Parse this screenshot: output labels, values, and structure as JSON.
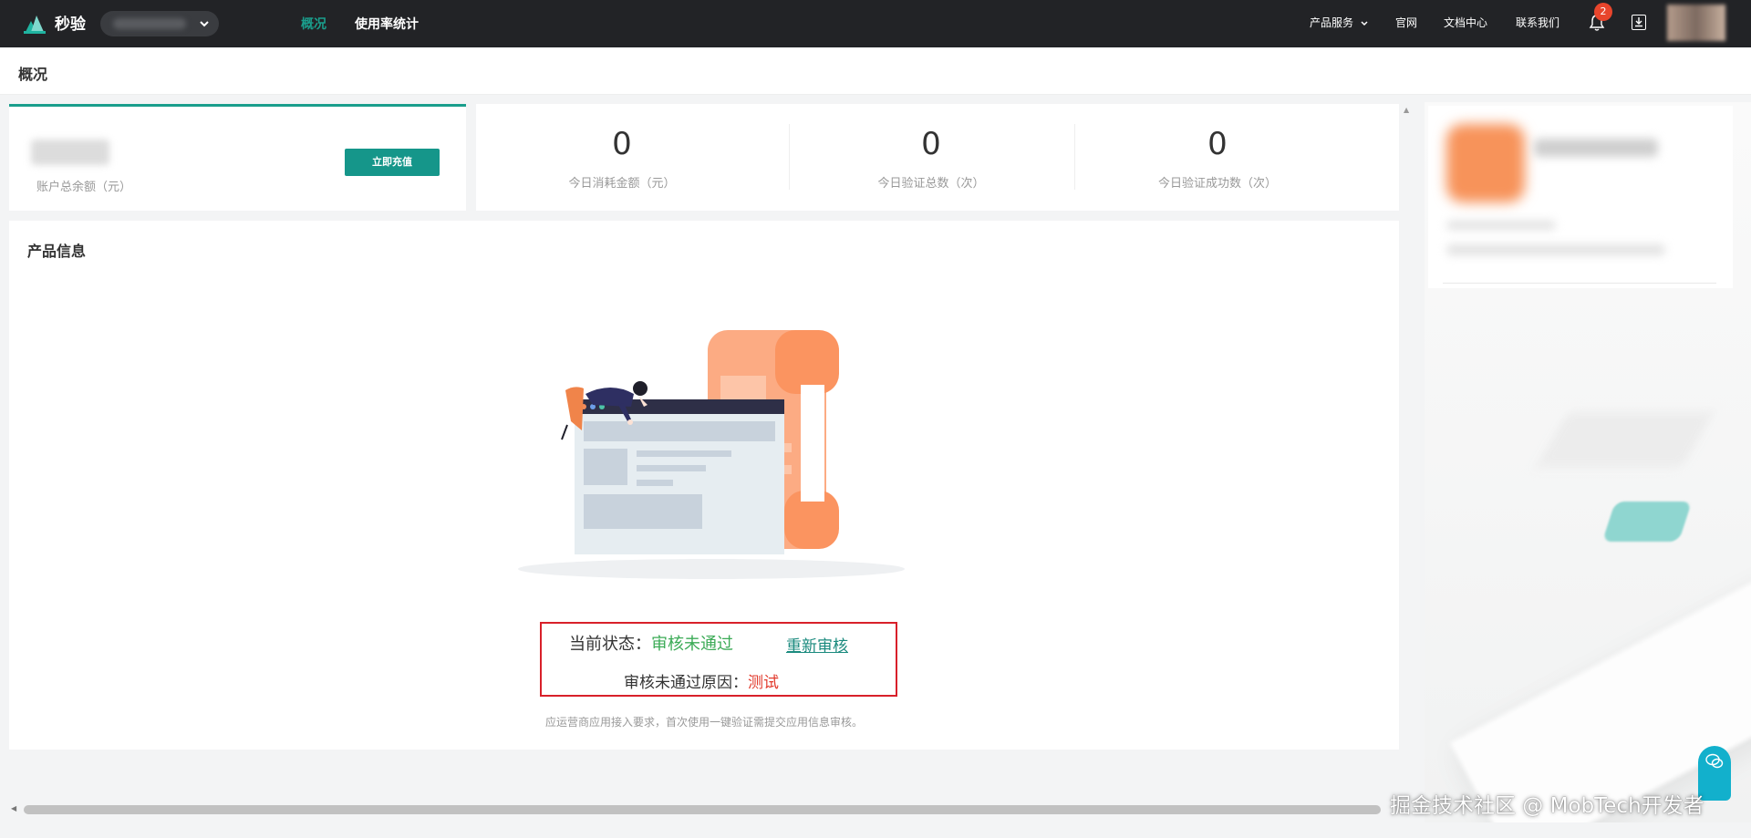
{
  "app": {
    "name": "秒验",
    "accent_color": "#1a9e8c"
  },
  "nav": {
    "tabs": [
      {
        "label": "概况",
        "active": true
      },
      {
        "label": "使用率统计",
        "active": false
      }
    ],
    "right": {
      "product_service": "产品服务",
      "official_site": "官网",
      "docs": "文档中心",
      "contact": "联系我们",
      "notification_count": "2"
    }
  },
  "page": {
    "title": "概况"
  },
  "balance": {
    "label": "账户总余额（元）",
    "recharge_button": "立即充值"
  },
  "stats": [
    {
      "value": "0",
      "label": "今日消耗金额（元）"
    },
    {
      "value": "0",
      "label": "今日验证总数（次）"
    },
    {
      "value": "0",
      "label": "今日验证成功数（次）"
    }
  ],
  "product": {
    "title": "产品信息",
    "status_label": "当前状态：",
    "status_value": "审核未通过",
    "recheck_link": "重新审核",
    "reason_label": "审核未通过原因：",
    "reason_value": "测试",
    "hint": "应运营商应用接入要求，首次使用一键验证需提交应用信息审核。",
    "status_color": "#3cab57",
    "reason_color": "#e23a2c",
    "highlight_box_color": "#d8202a"
  },
  "watermark": "掘金技术社区 @ MobTech开发者",
  "icons": [
    "logo-icon",
    "chevron-down-icon",
    "bell-icon",
    "download-icon",
    "chat-icon"
  ]
}
